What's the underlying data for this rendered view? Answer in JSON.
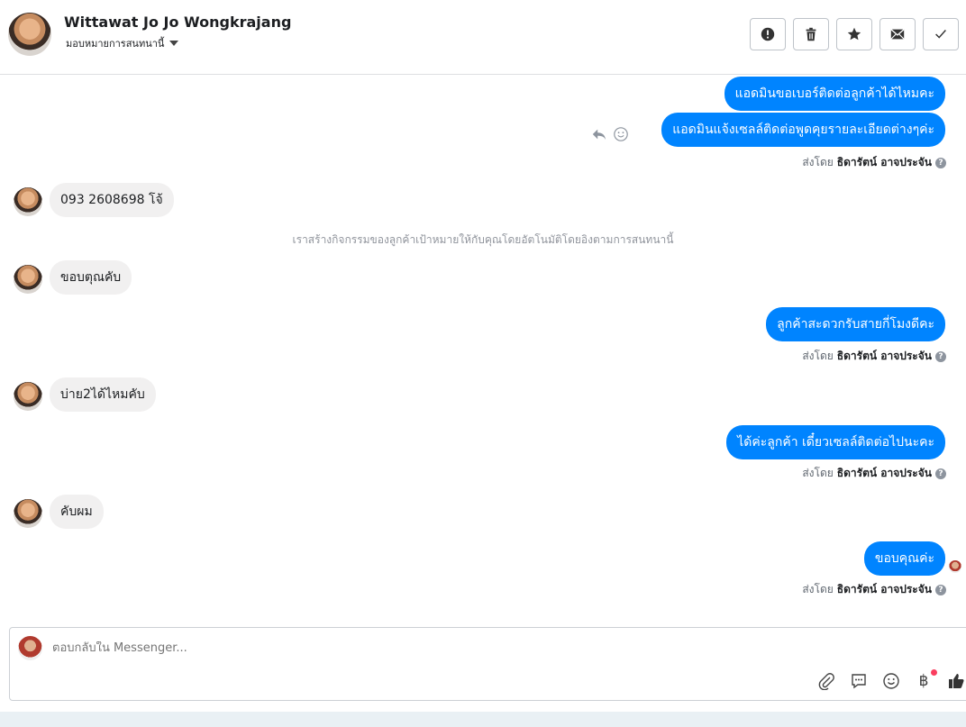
{
  "header": {
    "contact_name": "Wittawat Jo Jo Wongkrajang",
    "assign_label": "มอบหมายการสนทนานี้",
    "actions": [
      "alert-icon",
      "trash-icon",
      "star-icon",
      "mail-icon",
      "check-icon"
    ]
  },
  "messages": {
    "out1": "แอดมินขอเบอร์ติดต่อลูกค้าได้ไหมคะ",
    "out2": "แอดมินแจ้งเซลล์ติดต่อพูดคุยรายละเอียดต่างๆค่ะ",
    "sent_by_prefix": "ส่งโดย",
    "sent_by_name": "ธิดารัตน์ อาจประจัน",
    "in1": "093 2608698 โจ้",
    "system_note": "เราสร้างกิจกรรมของลูกค้าเป้าหมายให้กับคุณโดยอัตโนมัติโดยอิงตามการสนทนานี้",
    "in2": "ขอบตุณคับ",
    "out3": "ลูกค้าสะดวกรับสายกี่โมงดีคะ",
    "in3": "บ่าย2ได้ไหมคับ",
    "out4": "ได้ค่ะลูกค้า เดี๋ยวเซลล์ติดต่อไปนะคะ",
    "in4": "คับผม",
    "out5": "ขอบคุณค่ะ"
  },
  "composer": {
    "placeholder": "ตอบกลับใน Messenger...",
    "baht_symbol": "฿",
    "tools": [
      "attachment-icon",
      "saved-reply-icon",
      "emoji-icon",
      "payment-icon",
      "like-icon"
    ]
  },
  "colors": {
    "outgoing_bubble": "#0084ff",
    "incoming_bubble": "#f1f0f0",
    "accent_dot": "#fa3e5f"
  }
}
